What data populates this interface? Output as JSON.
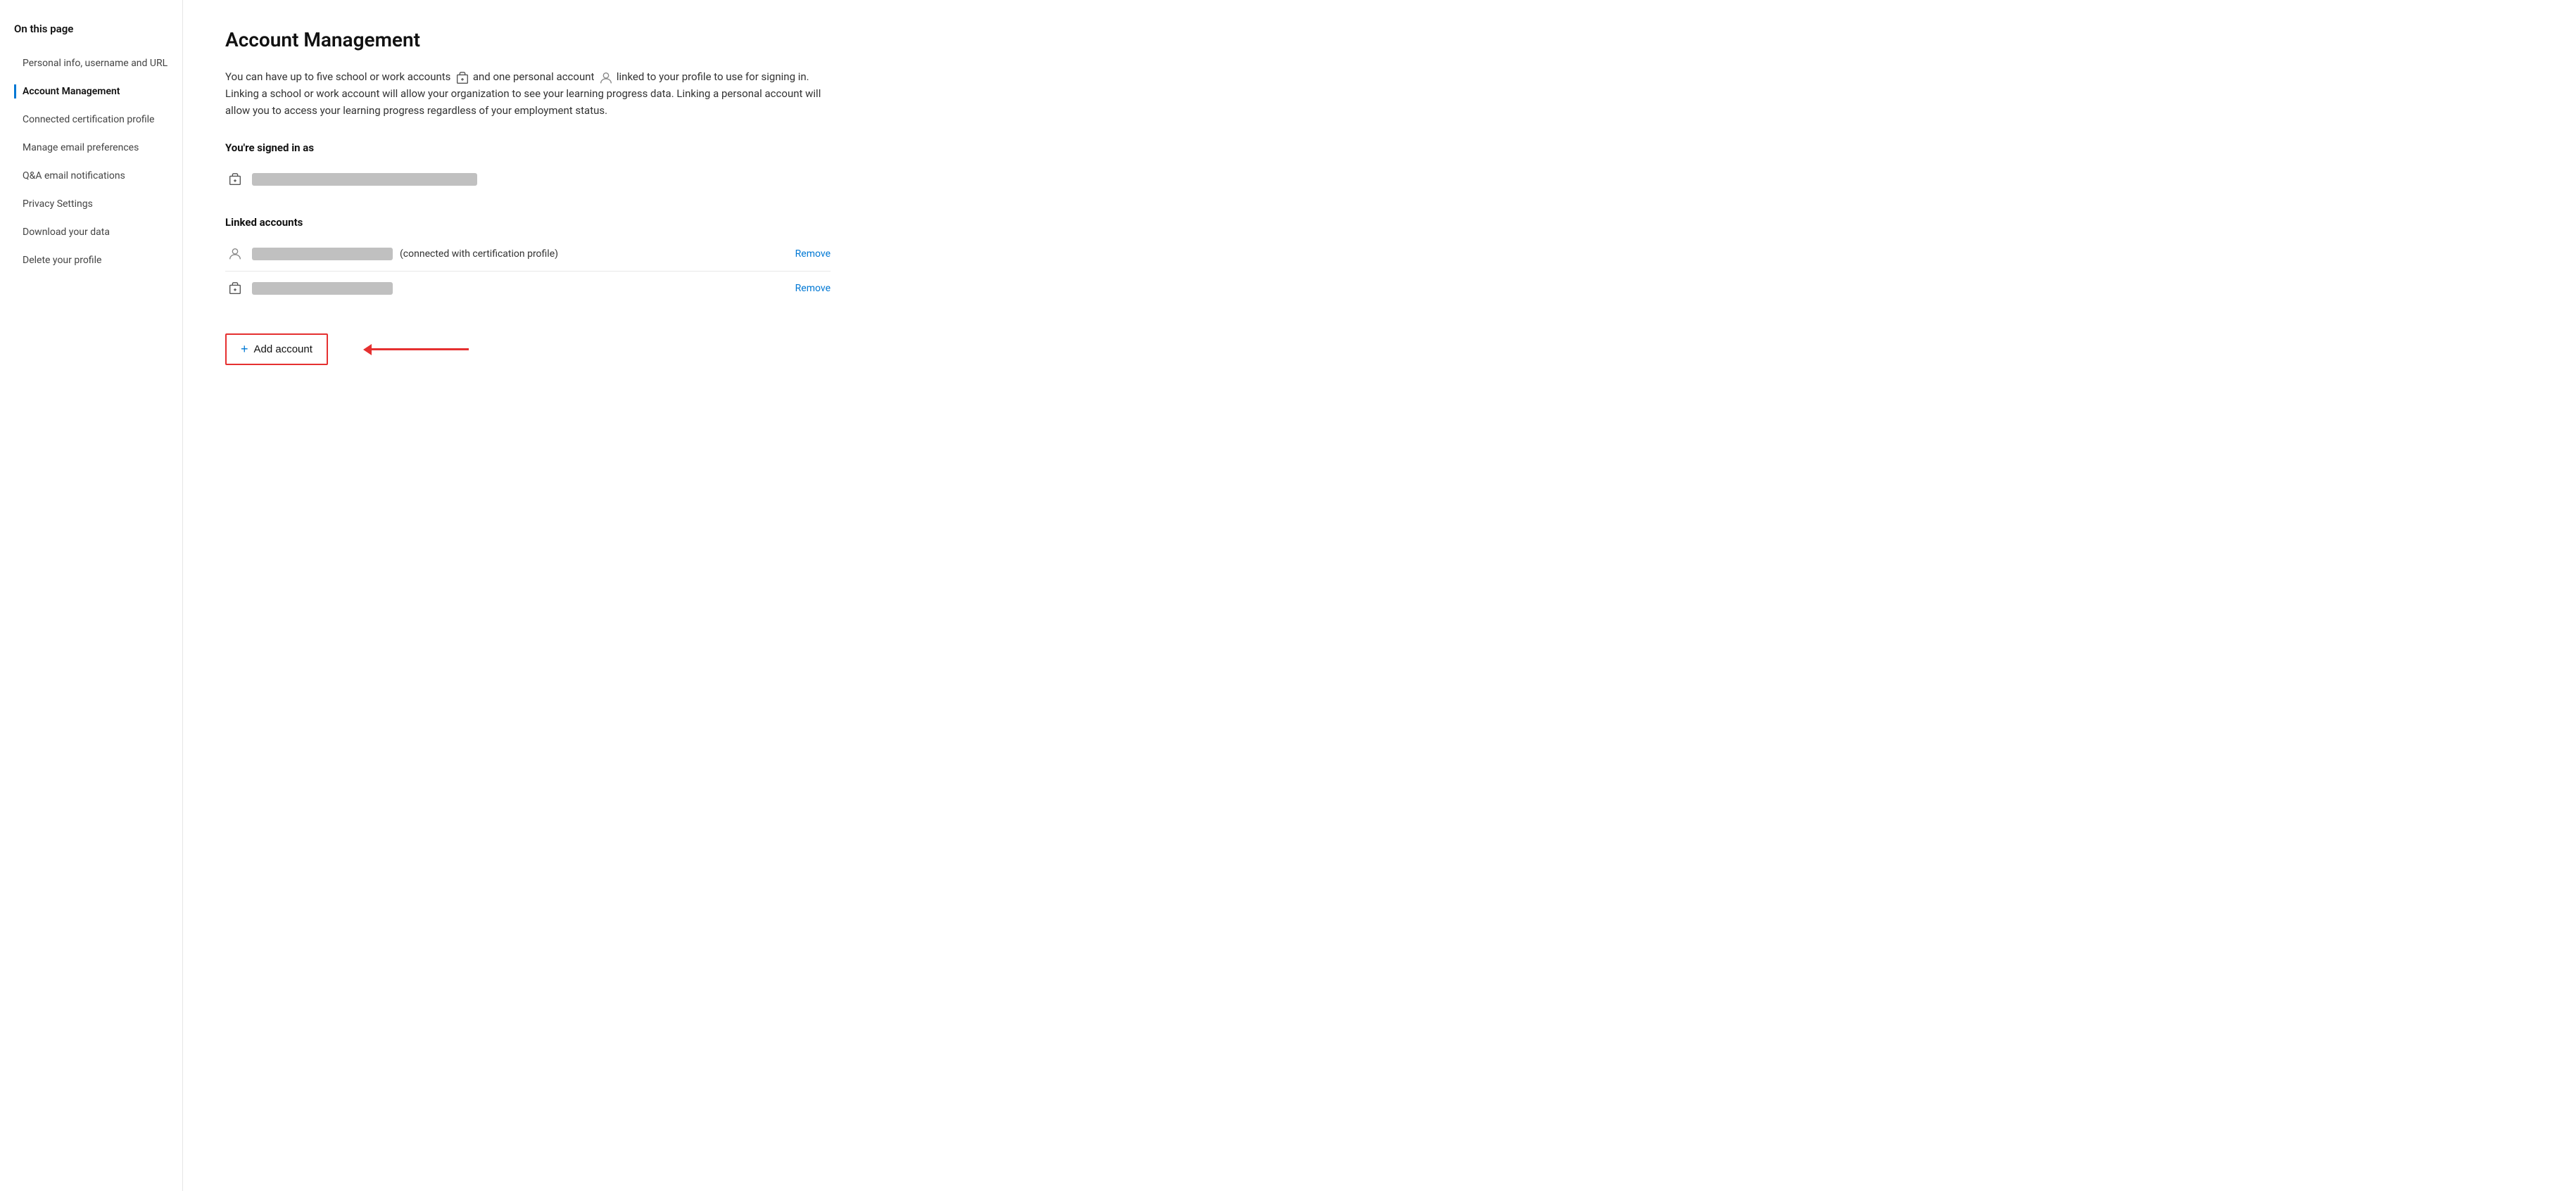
{
  "sidebar": {
    "heading": "On this page",
    "items": [
      {
        "id": "personal-info",
        "label": "Personal info, username and URL",
        "active": false
      },
      {
        "id": "account-management",
        "label": "Account Management",
        "active": true
      },
      {
        "id": "certification-profile",
        "label": "Connected certification profile",
        "active": false
      },
      {
        "id": "email-preferences",
        "label": "Manage email preferences",
        "active": false
      },
      {
        "id": "qa-notifications",
        "label": "Q&A email notifications",
        "active": false
      },
      {
        "id": "privacy-settings",
        "label": "Privacy Settings",
        "active": false
      },
      {
        "id": "download-data",
        "label": "Download your data",
        "active": false
      },
      {
        "id": "delete-profile",
        "label": "Delete your profile",
        "active": false
      }
    ]
  },
  "main": {
    "title": "Account Management",
    "description": "You can have up to five school or work accounts  and one personal account  linked to your profile to use for signing in. Linking a school or work account will allow your organization to see your learning progress data. Linking a personal account will allow you to access your learning progress regardless of your employment status.",
    "signed_in_section": {
      "label": "You're signed in as"
    },
    "linked_section": {
      "label": "Linked accounts"
    },
    "linked_accounts": [
      {
        "type": "personal",
        "connected_text": "(connected with certification profile)",
        "remove_label": "Remove"
      },
      {
        "type": "work",
        "connected_text": "",
        "remove_label": "Remove"
      }
    ],
    "add_account_button": "+ Add account",
    "add_account_plus": "+",
    "add_account_text": "Add account"
  }
}
